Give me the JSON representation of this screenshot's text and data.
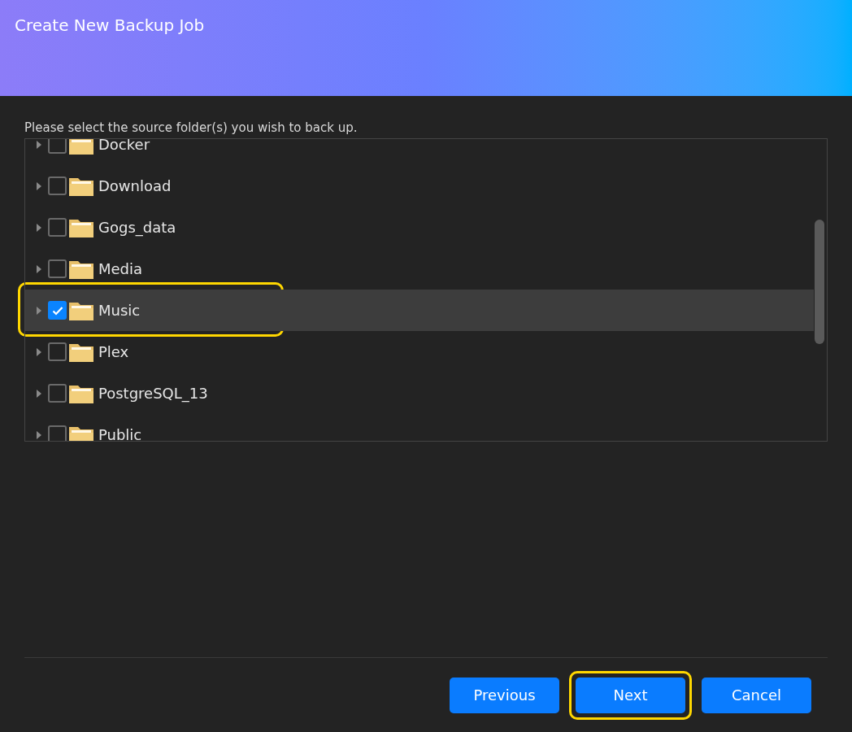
{
  "window": {
    "title": "Create New Backup Job"
  },
  "instruction": "Please select the source folder(s) you wish to back up.",
  "folders": [
    {
      "name": "Docker",
      "checked": false,
      "selected": false,
      "highlighted": false
    },
    {
      "name": "Download",
      "checked": false,
      "selected": false,
      "highlighted": false
    },
    {
      "name": "Gogs_data",
      "checked": false,
      "selected": false,
      "highlighted": false
    },
    {
      "name": "Media",
      "checked": false,
      "selected": false,
      "highlighted": false
    },
    {
      "name": "Music",
      "checked": true,
      "selected": true,
      "highlighted": true
    },
    {
      "name": "Plex",
      "checked": false,
      "selected": false,
      "highlighted": false
    },
    {
      "name": "PostgreSQL_13",
      "checked": false,
      "selected": false,
      "highlighted": false
    },
    {
      "name": "Public",
      "checked": false,
      "selected": false,
      "highlighted": false
    }
  ],
  "buttons": [
    {
      "label": "Previous",
      "highlighted": false
    },
    {
      "label": "Next",
      "highlighted": true
    },
    {
      "label": "Cancel",
      "highlighted": false
    }
  ]
}
